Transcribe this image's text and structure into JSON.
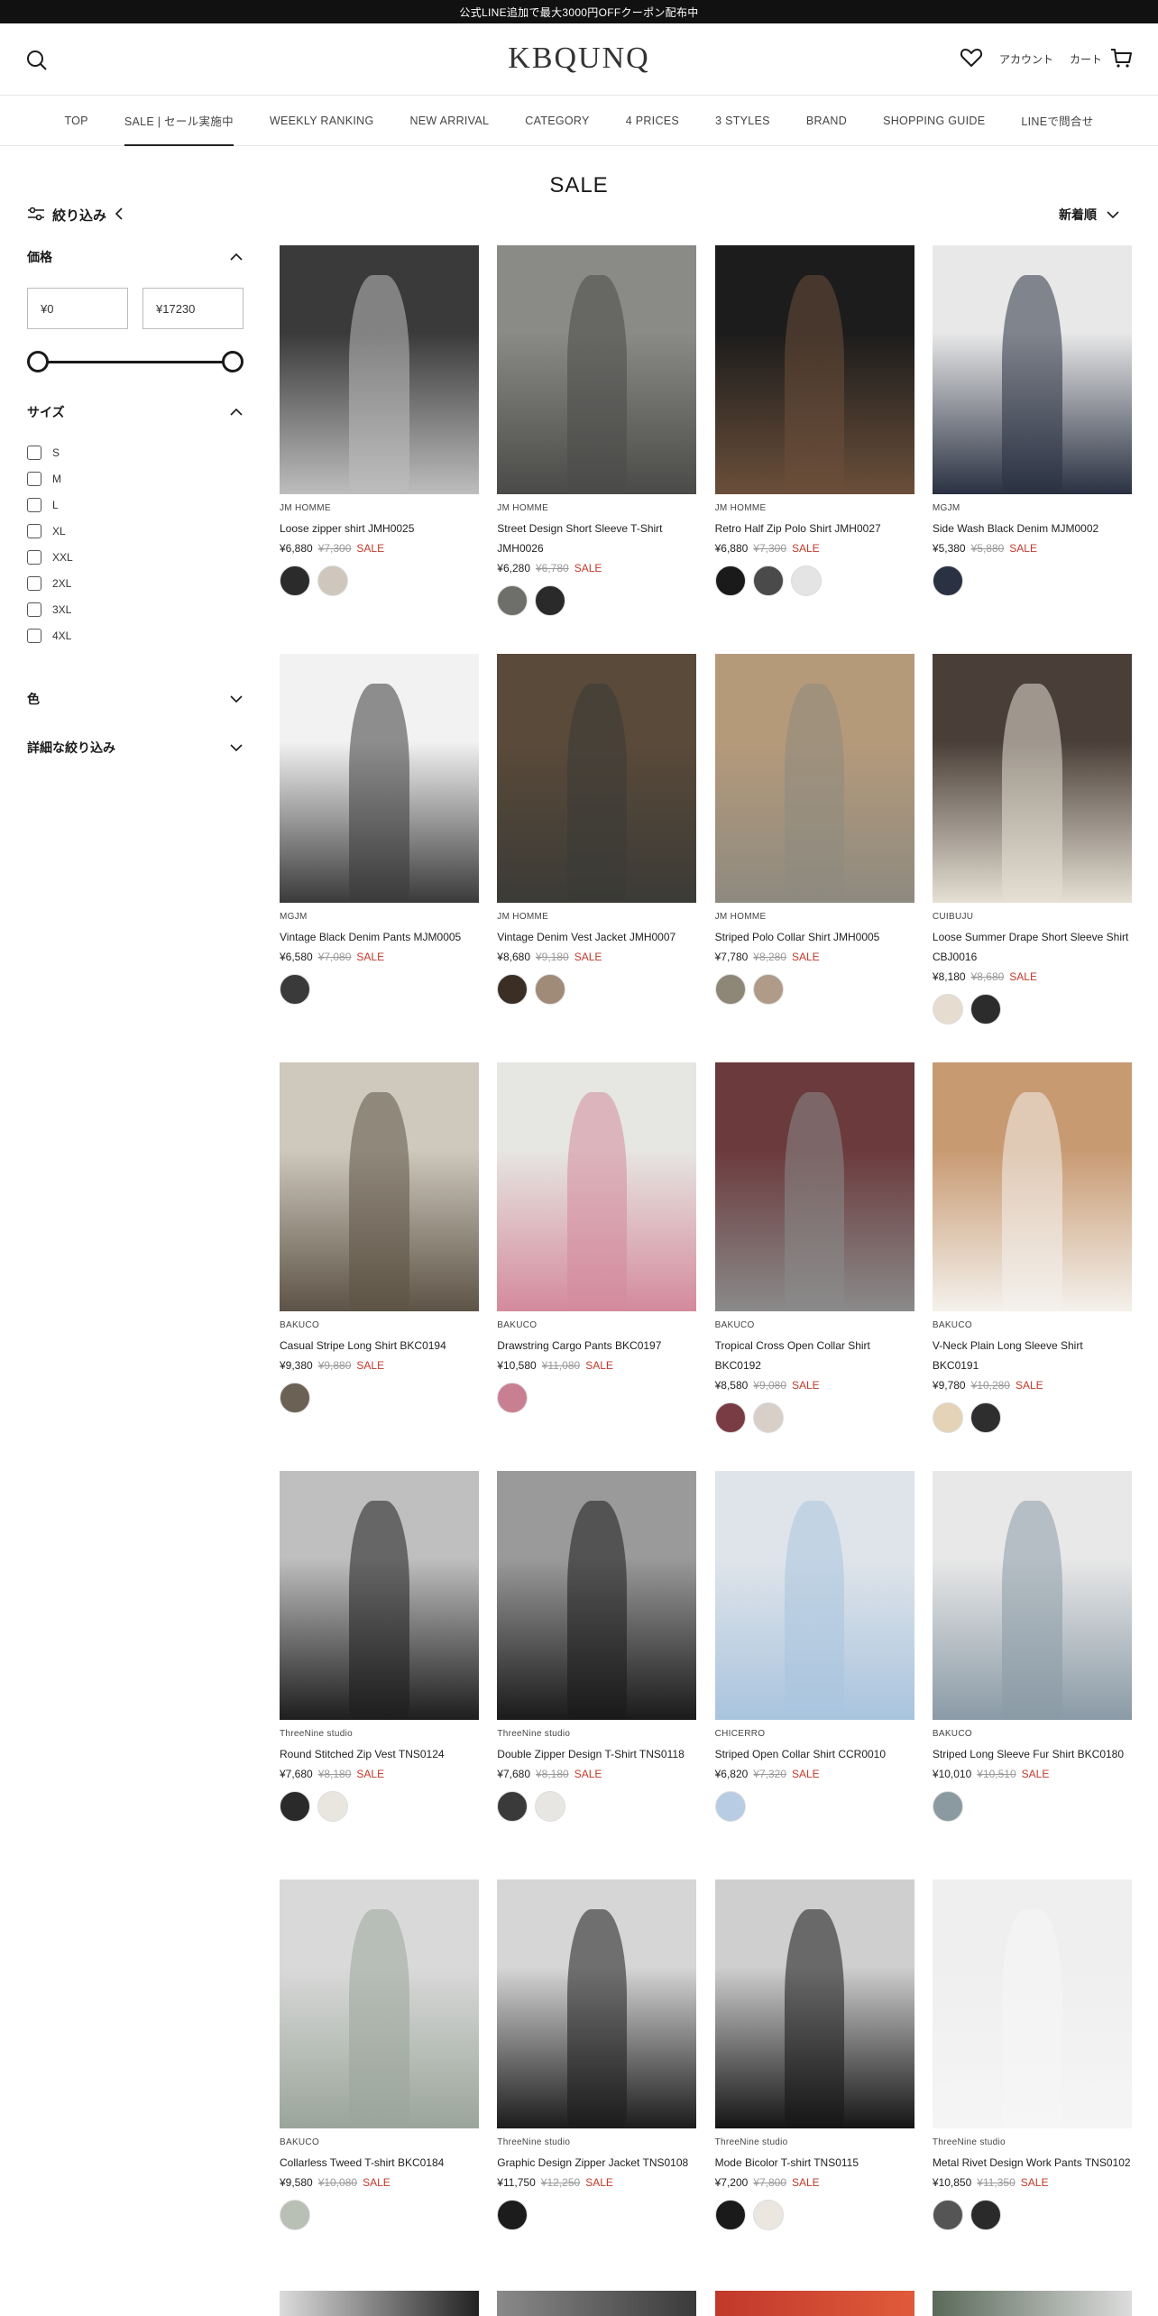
{
  "announcement": "公式LINE追加で最大3000円OFFクーポン配布中",
  "header": {
    "logo": "KBQUNQ",
    "account_label": "アカウント",
    "cart_label": "カート",
    "icons": [
      "search-icon",
      "heart-icon",
      "cart-icon"
    ]
  },
  "nav": [
    {
      "label": "TOP"
    },
    {
      "label": "SALE | セール実施中",
      "active": true
    },
    {
      "label": "WEEKLY RANKING"
    },
    {
      "label": "NEW ARRIVAL"
    },
    {
      "label": "CATEGORY"
    },
    {
      "label": "4 PRICES"
    },
    {
      "label": "3 STYLES"
    },
    {
      "label": "BRAND"
    },
    {
      "label": "SHOPPING GUIDE"
    },
    {
      "label": "LINEで問合せ"
    }
  ],
  "page_title": "SALE",
  "sort": {
    "label": "新着順"
  },
  "filters": {
    "toggle_label": "絞り込み",
    "price": {
      "title": "価格",
      "min": "¥0",
      "max": "¥17230",
      "range_low": 0,
      "range_high": 1
    },
    "size": {
      "title": "サイズ",
      "options": [
        "S",
        "M",
        "L",
        "XL",
        "XXL",
        "2XL",
        "3XL",
        "4XL"
      ]
    },
    "color": {
      "title": "色"
    },
    "advanced": {
      "title": "詳細な絞り込み"
    }
  },
  "colors": {
    "sale": "#c0392b",
    "announce_bg": "#111111"
  },
  "products": [
    {
      "brand": "JM HOMME",
      "name": "Loose zipper shirt JMH0025",
      "price": "¥6,880",
      "old_price": "¥7,300",
      "sale": "SALE",
      "img": [
        "#3a3a3a",
        "#bdbdbd"
      ],
      "swatches": [
        "#2b2b2b",
        "#cfc7bd"
      ]
    },
    {
      "brand": "JM HOMME",
      "name": "Street Design Short Sleeve T-Shirt JMH0026",
      "price": "¥6,280",
      "old_price": "¥6,780",
      "sale": "SALE",
      "img": [
        "#8a8a86",
        "#4a4a48"
      ],
      "swatches": [
        "#6e6e6a",
        "#2a2a2a"
      ]
    },
    {
      "brand": "JM HOMME",
      "name": "Retro Half Zip Polo Shirt JMH0027",
      "price": "¥6,880",
      "old_price": "¥7,300",
      "sale": "SALE",
      "img": [
        "#1c1c1c",
        "#6b4f3a"
      ],
      "swatches": [
        "#1a1a1a",
        "#4a4a4a",
        "#e4e4e4"
      ]
    },
    {
      "brand": "MGJM",
      "name": "Side Wash Black Denim MJM0002",
      "price": "¥5,380",
      "old_price": "¥5,880",
      "sale": "SALE",
      "img": [
        "#e8e8e8",
        "#2a3142"
      ],
      "swatches": [
        "#2a3142"
      ]
    },
    {
      "brand": "MGJM",
      "name": "Vintage Black Denim Pants MJM0005",
      "price": "¥6,580",
      "old_price": "¥7,080",
      "sale": "SALE",
      "img": [
        "#f2f2f2",
        "#3a3a3a"
      ],
      "swatches": [
        "#3a3a3a"
      ]
    },
    {
      "brand": "JM HOMME",
      "name": "Vintage Denim Vest Jacket JMH0007",
      "price": "¥8,680",
      "old_price": "¥9,180",
      "sale": "SALE",
      "img": [
        "#5a4a3a",
        "#3b3b36"
      ],
      "swatches": [
        "#3a2e25",
        "#a08a78"
      ]
    },
    {
      "brand": "JM HOMME",
      "name": "Striped Polo Collar Shirt JMH0005",
      "price": "¥7,780",
      "old_price": "¥8,280",
      "sale": "SALE",
      "img": [
        "#b59a7a",
        "#8e8a80"
      ],
      "swatches": [
        "#8e8676",
        "#b09a88"
      ]
    },
    {
      "brand": "CUIBUJU",
      "name": "Loose Summer Drape Short Sleeve Shirt CBJ0016",
      "price": "¥8,180",
      "old_price": "¥8,680",
      "sale": "SALE",
      "img": [
        "#4a3f38",
        "#e6e0d4"
      ],
      "swatches": [
        "#e6dccf",
        "#2c2c2c"
      ]
    },
    {
      "brand": "BAKUCO",
      "name": "Casual Stripe Long Shirt BKC0194",
      "price": "¥9,380",
      "old_price": "¥9,880",
      "sale": "SALE",
      "img": [
        "#cfc8bd",
        "#5d5346"
      ],
      "swatches": [
        "#6b6155"
      ]
    },
    {
      "brand": "BAKUCO",
      "name": "Drawstring Cargo Pants BKC0197",
      "price": "¥10,580",
      "old_price": "¥11,080",
      "sale": "SALE",
      "img": [
        "#e6e6e2",
        "#d48a9c"
      ],
      "swatches": [
        "#c97f92"
      ]
    },
    {
      "brand": "BAKUCO",
      "name": "Tropical Cross Open Collar Shirt BKC0192",
      "price": "¥8,580",
      "old_price": "¥9,080",
      "sale": "SALE",
      "img": [
        "#6b3a3c",
        "#8a8a8a"
      ],
      "swatches": [
        "#7a3c44",
        "#d8cfc8"
      ]
    },
    {
      "brand": "BAKUCO",
      "name": "V-Neck Plain Long Sleeve Shirt BKC0191",
      "price": "¥9,780",
      "old_price": "¥10,280",
      "sale": "SALE",
      "img": [
        "#c89a72",
        "#f4f1ec"
      ],
      "swatches": [
        "#e4d3b6",
        "#2e2e2e"
      ]
    },
    {
      "brand": "ThreeNine studio",
      "name": "Round Stitched Zip Vest TNS0124",
      "price": "¥7,680",
      "old_price": "¥8,180",
      "sale": "SALE",
      "img": [
        "#bfbfbf",
        "#1e1e1e"
      ],
      "swatches": [
        "#2a2a2a",
        "#e8e6df"
      ]
    },
    {
      "brand": "ThreeNine studio",
      "name": "Double Zipper Design T-Shirt TNS0118",
      "price": "¥7,680",
      "old_price": "¥8,180",
      "sale": "SALE",
      "img": [
        "#9a9a9a",
        "#1a1a1a"
      ],
      "swatches": [
        "#3a3a3a",
        "#e8e6e2"
      ]
    },
    {
      "brand": "CHICERRO",
      "name": "Striped Open Collar Shirt CCR0010",
      "price": "¥6,820",
      "old_price": "¥7,320",
      "sale": "SALE",
      "img": [
        "#dfe4ea",
        "#a9c4de"
      ],
      "swatches": [
        "#b8cde4"
      ]
    },
    {
      "brand": "BAKUCO",
      "name": "Striped Long Sleeve Fur Shirt BKC0180",
      "price": "¥10,010",
      "old_price": "¥10,510",
      "sale": "SALE",
      "img": [
        "#e8e8e8",
        "#8a9aa6"
      ],
      "swatches": [
        "#8a9aa0"
      ]
    },
    {
      "brand": "BAKUCO",
      "name": "Collarless Tweed T-shirt BKC0184",
      "price": "¥9,580",
      "old_price": "¥10,080",
      "sale": "SALE",
      "img": [
        "#d9d9d9",
        "#9aa59a"
      ],
      "swatches": [
        "#b8bfb5"
      ]
    },
    {
      "brand": "ThreeNine studio",
      "name": "Graphic Design Zipper Jacket TNS0108",
      "price": "¥11,750",
      "old_price": "¥12,250",
      "sale": "SALE",
      "img": [
        "#d6d6d6",
        "#1c1c1c"
      ],
      "swatches": [
        "#1c1c1c"
      ]
    },
    {
      "brand": "ThreeNine studio",
      "name": "Mode Bicolor T-shirt TNS0115",
      "price": "¥7,200",
      "old_price": "¥7,800",
      "sale": "SALE",
      "img": [
        "#cfcfcf",
        "#151515"
      ],
      "swatches": [
        "#1a1a1a",
        "#ebe7e0"
      ]
    },
    {
      "brand": "ThreeNine studio",
      "name": "Metal Rivet Design Work Pants TNS0102",
      "price": "¥10,850",
      "old_price": "¥11,350",
      "sale": "SALE",
      "img": [
        "#efefef",
        "#f5f5f5"
      ],
      "swatches": [
        "#555555",
        "#2a2a2a"
      ]
    }
  ],
  "partial_row_colors": [
    [
      "#dcdcdc",
      "#222"
    ],
    [
      "#8a8a8a",
      "#3a3a3a"
    ],
    [
      "#c0392b",
      "#e05a3a"
    ],
    [
      "#5a6a5a",
      "#dcdcdc"
    ]
  ]
}
